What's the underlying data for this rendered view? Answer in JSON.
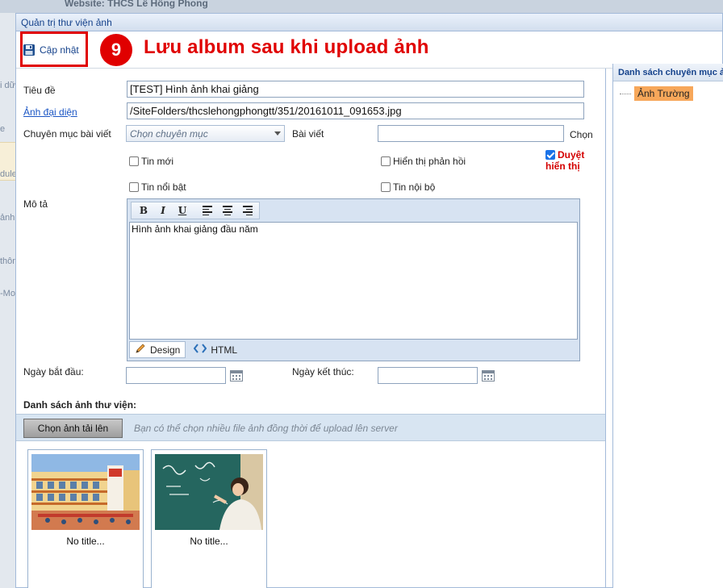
{
  "site": {
    "title": "Website: THCS Lê Hồng Phong"
  },
  "bg_fragments": [
    "i dữ",
    "e",
    "dule",
    "ảnh p",
    "thôn",
    "-Mo"
  ],
  "dialog": {
    "title": "Quản trị thư viện ảnh"
  },
  "toolbar": {
    "save_label": "Cập nhật",
    "step_number": "9",
    "step_text": "Lưu album sau khi upload ảnh"
  },
  "form": {
    "title_label": "Tiêu đề",
    "title_value": "[TEST] Hình ảnh khai giảng",
    "image_label": "Ảnh đại diện",
    "image_value": "/SiteFolders/thcslehongphongtt/351/20161011_091653.jpg",
    "category_label": "Chuyên mục bài viết",
    "category_placeholder": "Chọn chuyên mục",
    "post_label": "Bài viết",
    "post_value": "",
    "choose_label": "Chọn",
    "chk_new": "Tin mới",
    "chk_featured": "Tin nổi bật",
    "chk_show_feedback": "Hiển thị phản hồi",
    "chk_internal": "Tin nội bộ",
    "approve_line1": "Duyệt",
    "approve_line2": "hiển thị",
    "desc_label": "Mô tả",
    "desc_value": "Hình ảnh khai giảng đầu năm",
    "editor_bold": "B",
    "editor_italic": "I",
    "editor_underline": "U",
    "mode_design": "Design",
    "mode_html": "HTML",
    "start_label": "Ngày bắt đầu:",
    "start_value": "",
    "end_label": "Ngày kết thúc:",
    "end_value": ""
  },
  "gallery": {
    "title": "Danh sách ảnh thư viện:",
    "upload_button": "Chọn ảnh tải lên",
    "upload_hint": "Bạn có thể chọn nhiều file ảnh đồng thời để upload lên server",
    "items": [
      {
        "caption": "No title..."
      },
      {
        "caption": "No title..."
      }
    ]
  },
  "sidebar": {
    "title": "Danh sách chuyên mục ảnh",
    "items": [
      {
        "label": "Ảnh Trường"
      }
    ]
  },
  "colors": {
    "accent": "#e00000",
    "link": "#1a55c4",
    "header_text": "#15428b",
    "tree_highlight": "#f7a75a"
  }
}
